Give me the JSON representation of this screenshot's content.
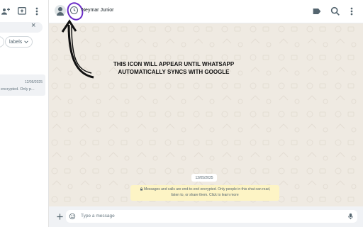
{
  "sidebar": {
    "search_clear": "×",
    "filter_chip": "labels",
    "chat_item": {
      "date": "12/05/2025",
      "preview": "encrypted. Only p..."
    }
  },
  "header": {
    "contact_name": "Neymar Junior"
  },
  "annotation": {
    "line1": "THIS ICON WILL APPEAR UNTIL WHATSAPP",
    "line2": "AUTOMATICALLY SYNCS WITH GOOGLE"
  },
  "messages": {
    "date": "12/05/2025",
    "encryption_line1": "Messages and calls are end-to-end encrypted. Only people in this chat can read,",
    "encryption_line2": "listen to, or share them. Click to learn more"
  },
  "composer": {
    "placeholder": "Type a message"
  },
  "colors": {
    "chat_bg": "#efeae2",
    "notice_bg": "#fdf4c5",
    "annotation_circle": "#6a2cc7"
  }
}
